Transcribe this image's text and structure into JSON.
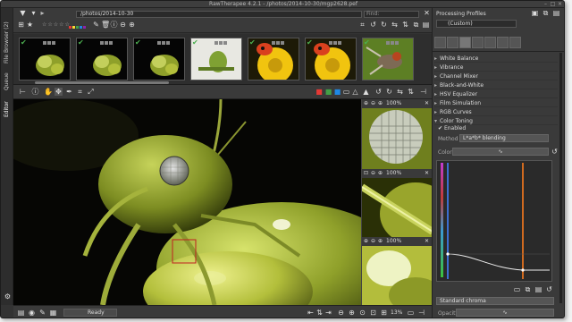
{
  "window": {
    "title": "RawTherapee 4.2.1 - /photos/2014-10-30/mgp2628.pef"
  },
  "vertical_tabs": [
    "File Browser (2)",
    "Queue",
    "Editor"
  ],
  "filebrowser": {
    "path_value": "/photos/2014-10-30",
    "find_placeholder": "Find:",
    "stars": "☆☆☆☆☆",
    "thumbs": [
      {
        "checked": true,
        "scene": "aphid-dark"
      },
      {
        "checked": true,
        "scene": "aphid-dark"
      },
      {
        "checked": true,
        "scene": "aphid-dark"
      },
      {
        "checked": true,
        "scene": "bud-white"
      },
      {
        "checked": true,
        "scene": "ladybug-yellow"
      },
      {
        "checked": true,
        "scene": "ladybug-yellow"
      },
      {
        "checked": true,
        "scene": "fly-green"
      }
    ],
    "swatch_colors": [
      "#e53935",
      "#fdd835",
      "#43a047",
      "#1e88e5",
      "#8e24aa"
    ]
  },
  "editor_bottom": {
    "status": "Ready",
    "zoom": "13%"
  },
  "detail_windows": [
    {
      "zoom": "100%"
    },
    {
      "zoom": "100%"
    },
    {
      "zoom": "100%"
    }
  ],
  "processing_profiles": {
    "header": "Processing Profiles",
    "profile_value": "(Custom)",
    "tools": [
      {
        "label": "White Balance",
        "open": false
      },
      {
        "label": "Vibrance",
        "open": false
      },
      {
        "label": "Channel Mixer",
        "open": false
      },
      {
        "label": "Black-and-White",
        "open": false
      },
      {
        "label": "HSV Equalizer",
        "open": false
      },
      {
        "label": "Film Simulation",
        "open": false
      },
      {
        "label": "RGB Curves",
        "open": false
      },
      {
        "label": "Color Toning",
        "open": true
      }
    ],
    "enabled_label": "Enabled",
    "method_label": "Method",
    "method_value": "L*a*b* blending",
    "color_label": "Color",
    "chroma_value": "Standard chroma",
    "opacity_label": "Opacity"
  }
}
